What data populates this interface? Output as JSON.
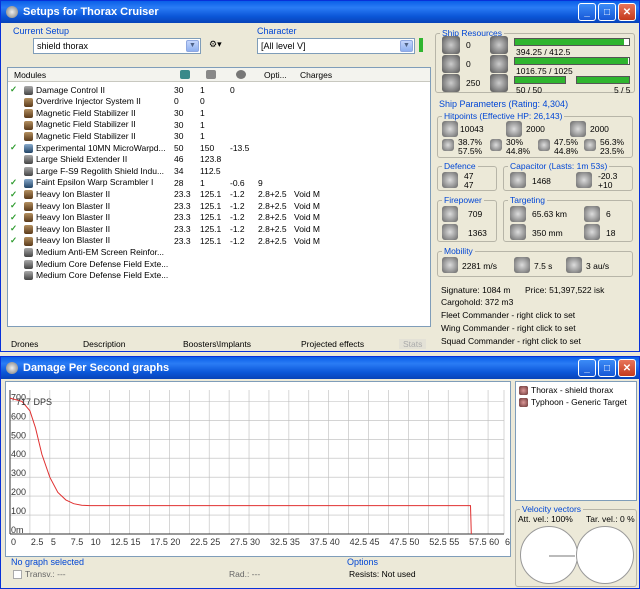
{
  "setups_window": {
    "title": "Setups for Thorax Cruiser",
    "current_setup_label": "Current Setup",
    "current_setup_value": "shield thorax",
    "character_label": "Character",
    "character_value": "[All level V]",
    "module_columns": [
      "Modules",
      "",
      "",
      "",
      "Opti...",
      "Charges"
    ],
    "modules": [
      {
        "name": "Damage Control II",
        "active": true,
        "icon": "g",
        "c1": "30",
        "c2": "1",
        "c3": "0",
        "opt": "",
        "charge": ""
      },
      {
        "name": "Overdrive Injector System II",
        "active": false,
        "icon": "",
        "c1": "0",
        "c2": "0",
        "c3": "",
        "opt": "",
        "charge": ""
      },
      {
        "name": "Magnetic Field Stabilizer II",
        "active": false,
        "icon": "",
        "c1": "30",
        "c2": "1",
        "c3": "",
        "opt": "",
        "charge": ""
      },
      {
        "name": "Magnetic Field Stabilizer II",
        "active": false,
        "icon": "",
        "c1": "30",
        "c2": "1",
        "c3": "",
        "opt": "",
        "charge": ""
      },
      {
        "name": "Magnetic Field Stabilizer II",
        "active": false,
        "icon": "",
        "c1": "30",
        "c2": "1",
        "c3": "",
        "opt": "",
        "charge": ""
      },
      {
        "name": "Experimental 10MN MicroWarpd...",
        "active": true,
        "icon": "b",
        "c1": "50",
        "c2": "150",
        "c3": "-13.5",
        "opt": "",
        "charge": ""
      },
      {
        "name": "Large Shield Extender II",
        "active": false,
        "icon": "g",
        "c1": "46",
        "c2": "123.8",
        "c3": "",
        "opt": "",
        "charge": ""
      },
      {
        "name": "Large F-S9 Regolith Shield Indu...",
        "active": false,
        "icon": "g",
        "c1": "34",
        "c2": "112.5",
        "c3": "",
        "opt": "",
        "charge": ""
      },
      {
        "name": "Faint Epsilon Warp Scrambler I",
        "active": true,
        "icon": "b",
        "c1": "28",
        "c2": "1",
        "c3": "-0.6",
        "opt": "9",
        "charge": ""
      },
      {
        "name": "Heavy Ion Blaster II",
        "active": true,
        "icon": "",
        "c1": "23.3",
        "c2": "125.1",
        "c3": "-1.2",
        "opt": "2.8+2.5",
        "charge": "Void M"
      },
      {
        "name": "Heavy Ion Blaster II",
        "active": true,
        "icon": "",
        "c1": "23.3",
        "c2": "125.1",
        "c3": "-1.2",
        "opt": "2.8+2.5",
        "charge": "Void M"
      },
      {
        "name": "Heavy Ion Blaster II",
        "active": true,
        "icon": "",
        "c1": "23.3",
        "c2": "125.1",
        "c3": "-1.2",
        "opt": "2.8+2.5",
        "charge": "Void M"
      },
      {
        "name": "Heavy Ion Blaster II",
        "active": true,
        "icon": "",
        "c1": "23.3",
        "c2": "125.1",
        "c3": "-1.2",
        "opt": "2.8+2.5",
        "charge": "Void M"
      },
      {
        "name": "Heavy Ion Blaster II",
        "active": true,
        "icon": "",
        "c1": "23.3",
        "c2": "125.1",
        "c3": "-1.2",
        "opt": "2.8+2.5",
        "charge": "Void M"
      },
      {
        "name": "Medium Anti-EM Screen Reinfor...",
        "active": false,
        "icon": "g",
        "c1": "",
        "c2": "",
        "c3": "",
        "opt": "",
        "charge": ""
      },
      {
        "name": "Medium Core Defense Field Exte...",
        "active": false,
        "icon": "g",
        "c1": "",
        "c2": "",
        "c3": "",
        "opt": "",
        "charge": ""
      },
      {
        "name": "Medium Core Defense Field Exte...",
        "active": false,
        "icon": "g",
        "c1": "",
        "c2": "",
        "c3": "",
        "opt": "",
        "charge": ""
      }
    ],
    "bottom_tabs": [
      "Drones",
      "Description",
      "Boosters\\Implants",
      "Projected effects",
      "Stats"
    ],
    "ship_resources": {
      "label": "Ship Resources",
      "turret_hardpoints": "0",
      "launcher_hardpoints": "0",
      "calibration": "250",
      "cpu": "394.25 / 412.5",
      "cpu_fraction": 0.956,
      "powergrid": "1016.75 / 1025",
      "powergrid_fraction": 0.992,
      "drone_bay": "50 / 50",
      "drone_bay_fraction": 1.0,
      "drone_count": "5 / 5",
      "drone_count_fraction": 1.0
    },
    "ship_parameters": {
      "label": "Ship Parameters (Rating: 4,304)",
      "hitpoints_label": "Hitpoints (Effective HP: 26,143)",
      "shield_hp": "10043",
      "armor_hp": "2000",
      "hull_hp": "2000",
      "shield_res_1": "38.7%",
      "shield_res_2": "57.5%",
      "armor_res_1": "30%",
      "armor_res_2": "44.8%",
      "hull_res_1": "47.5%",
      "hull_res_2": "44.8%",
      "explosive_res_1": "56.3%",
      "explosive_res_2": "23.5%",
      "defence_label": "Defence",
      "defence_1": "47",
      "defence_2": "47",
      "capacitor_label": "Capacitor (Lasts: 1m 53s)",
      "capacitor": "1468",
      "cap_recharge_1": "-20.3",
      "cap_recharge_2": "+10",
      "firepower_label": "Firepower",
      "firepower_1": "709",
      "firepower_2": "1363",
      "targeting_label": "Targeting",
      "target_range": "65.63 km",
      "max_targets": "6",
      "scan_res": "350 mm",
      "sensor_strength": "18",
      "mobility_label": "Mobility",
      "velocity": "2281 m/s",
      "align_time": "7.5 s",
      "warp_speed": "3 au/s",
      "signature": "Signature: 1084 m",
      "price": "Price: 51,397,522 isk",
      "cargohold": "Cargohold: 372 m3",
      "fleet_commander": "Fleet Commander - right click to set",
      "wing_commander": "Wing Commander - right click to set",
      "squad_commander": "Squad Commander - right click to set"
    }
  },
  "graph_window": {
    "title": "Damage Per Second graphs",
    "legend": [
      "Thorax - shield thorax",
      "Typhoon - Generic Target"
    ],
    "velocity_vectors_label": "Velocity vectors",
    "att_vel": "Att. vel.: 100%",
    "tar_vel": "Tar. vel.: 0 %",
    "no_graph_label": "No graph selected",
    "transv_label": "Transv.: ---",
    "rad_label": "Rad.: ---",
    "options_label": "Options",
    "resists_label": "Resists: Not used"
  },
  "chart_data": {
    "type": "line",
    "title": "",
    "xlabel": "",
    "ylabel": "",
    "y_tick_labels": [
      "700",
      "600",
      "500",
      "400",
      "300",
      "200",
      "100",
      "0m"
    ],
    "xlim": [
      0,
      62
    ],
    "ylim": [
      0,
      760
    ],
    "x_ticks": [
      "0",
      "2.5",
      "5",
      "7.5",
      "10",
      "12.5",
      "15",
      "17.5",
      "20",
      "22.5",
      "25",
      "27.5",
      "30",
      "32.5",
      "35",
      "37.5",
      "40",
      "42.5",
      "45",
      "47.5",
      "50",
      "52.5",
      "55",
      "57.5",
      "60",
      "62"
    ],
    "y_ticks": [
      700,
      600,
      500,
      400,
      300,
      200,
      100,
      0
    ],
    "annotation": "717 DPS",
    "grid": true,
    "series": [
      {
        "color": "#e03030",
        "x": [
          0,
          1.5,
          2.5,
          3.2,
          4,
          5,
          6,
          7,
          8,
          9,
          10,
          12,
          15,
          20,
          30,
          40,
          50,
          57,
          57.8,
          57.9
        ],
        "y": [
          717,
          700,
          650,
          560,
          420,
          300,
          220,
          180,
          160,
          152,
          150,
          150,
          150,
          150,
          150,
          150,
          150,
          150,
          150,
          0
        ]
      }
    ],
    "colors": {
      "line": "#e03030",
      "grid": "#bbbbbb"
    }
  }
}
